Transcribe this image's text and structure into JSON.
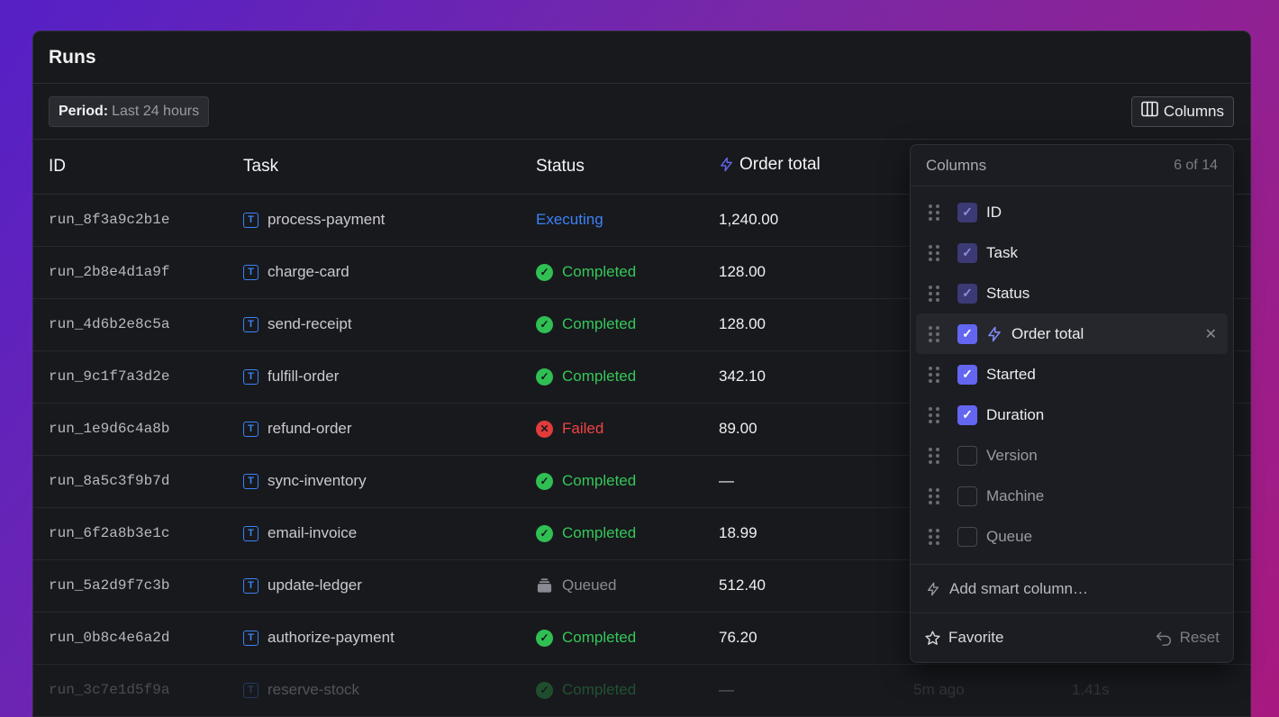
{
  "panel": {
    "title": "Runs",
    "period_label": "Period:",
    "period_value": "Last 24 hours",
    "columns_button": "Columns"
  },
  "table": {
    "headers": {
      "id": "ID",
      "task": "Task",
      "status": "Status",
      "order_total": "Order total"
    },
    "rows": [
      {
        "id": "run_8f3a9c2b1e",
        "task": "process-payment",
        "status": "Executing",
        "status_kind": "executing",
        "total": "1,240.00"
      },
      {
        "id": "run_2b8e4d1a9f",
        "task": "charge-card",
        "status": "Completed",
        "status_kind": "completed",
        "total": "128.00"
      },
      {
        "id": "run_4d6b2e8c5a",
        "task": "send-receipt",
        "status": "Completed",
        "status_kind": "completed",
        "total": "128.00"
      },
      {
        "id": "run_9c1f7a3d2e",
        "task": "fulfill-order",
        "status": "Completed",
        "status_kind": "completed",
        "total": "342.10"
      },
      {
        "id": "run_1e9d6c4a8b",
        "task": "refund-order",
        "status": "Failed",
        "status_kind": "failed",
        "total": "89.00"
      },
      {
        "id": "run_8a5c3f9b7d",
        "task": "sync-inventory",
        "status": "Completed",
        "status_kind": "completed",
        "total": "—"
      },
      {
        "id": "run_6f2a8b3e1c",
        "task": "email-invoice",
        "status": "Completed",
        "status_kind": "completed",
        "total": "18.99"
      },
      {
        "id": "run_5a2d9f7c3b",
        "task": "update-ledger",
        "status": "Queued",
        "status_kind": "queued",
        "total": "512.40"
      },
      {
        "id": "run_0b8c4e6a2d",
        "task": "authorize-payment",
        "status": "Completed",
        "status_kind": "completed",
        "total": "76.20"
      },
      {
        "id": "run_3c7e1d5f9a",
        "task": "reserve-stock",
        "status": "Completed",
        "status_kind": "completed",
        "total": "—",
        "started": "5m ago",
        "duration": "1.41s"
      }
    ]
  },
  "columns_popover": {
    "title": "Columns",
    "count": "6 of 14",
    "items": [
      {
        "label": "ID",
        "state": "locked"
      },
      {
        "label": "Task",
        "state": "locked"
      },
      {
        "label": "Status",
        "state": "locked"
      },
      {
        "label": "Order total",
        "state": "checked",
        "smart": true
      },
      {
        "label": "Started",
        "state": "checked"
      },
      {
        "label": "Duration",
        "state": "checked"
      },
      {
        "label": "Version",
        "state": "unchecked"
      },
      {
        "label": "Machine",
        "state": "unchecked"
      },
      {
        "label": "Queue",
        "state": "unchecked"
      }
    ],
    "add_smart": "Add smart column…",
    "favorite": "Favorite",
    "reset": "Reset"
  },
  "colors": {
    "accent": "#6366f1",
    "completed": "#34c759",
    "failed": "#ef4444",
    "executing": "#3b82f6",
    "queued": "#8a8b92"
  }
}
